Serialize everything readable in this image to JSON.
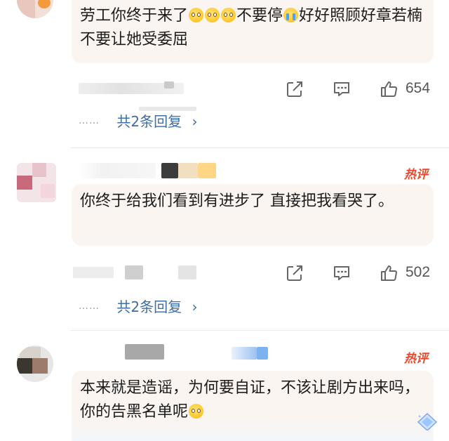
{
  "comments": [
    {
      "text_parts": [
        "劳工你终于来了",
        "不要停",
        "好好照顾好章若楠不要让她受委屈"
      ],
      "emoji_1": "rolling-eyes-emoji",
      "emoji_2": "crying-emoji",
      "likes": "654",
      "replies_label": "共2条回复",
      "reply_dots": "……"
    },
    {
      "hot_badge": "热评",
      "text": "你终于给我们看到有进步了 直接把我看哭了。",
      "likes": "502",
      "replies_label": "共2条回复",
      "reply_dots": "……"
    },
    {
      "hot_badge": "热评",
      "text": "本来就是造谣，为何要自证，不该让剧方出来吗，你的告黑名单呢",
      "emoji": "flushed-emoji"
    }
  ],
  "icons": {
    "share": "share-icon",
    "comment": "comment-icon",
    "like": "thumbs-up-icon",
    "chevron": "chevron-right-icon"
  },
  "colors": {
    "hot_badge": "#e8492e",
    "reply_link": "#3c6ea8",
    "bubble_bg": "#faf5f1"
  }
}
